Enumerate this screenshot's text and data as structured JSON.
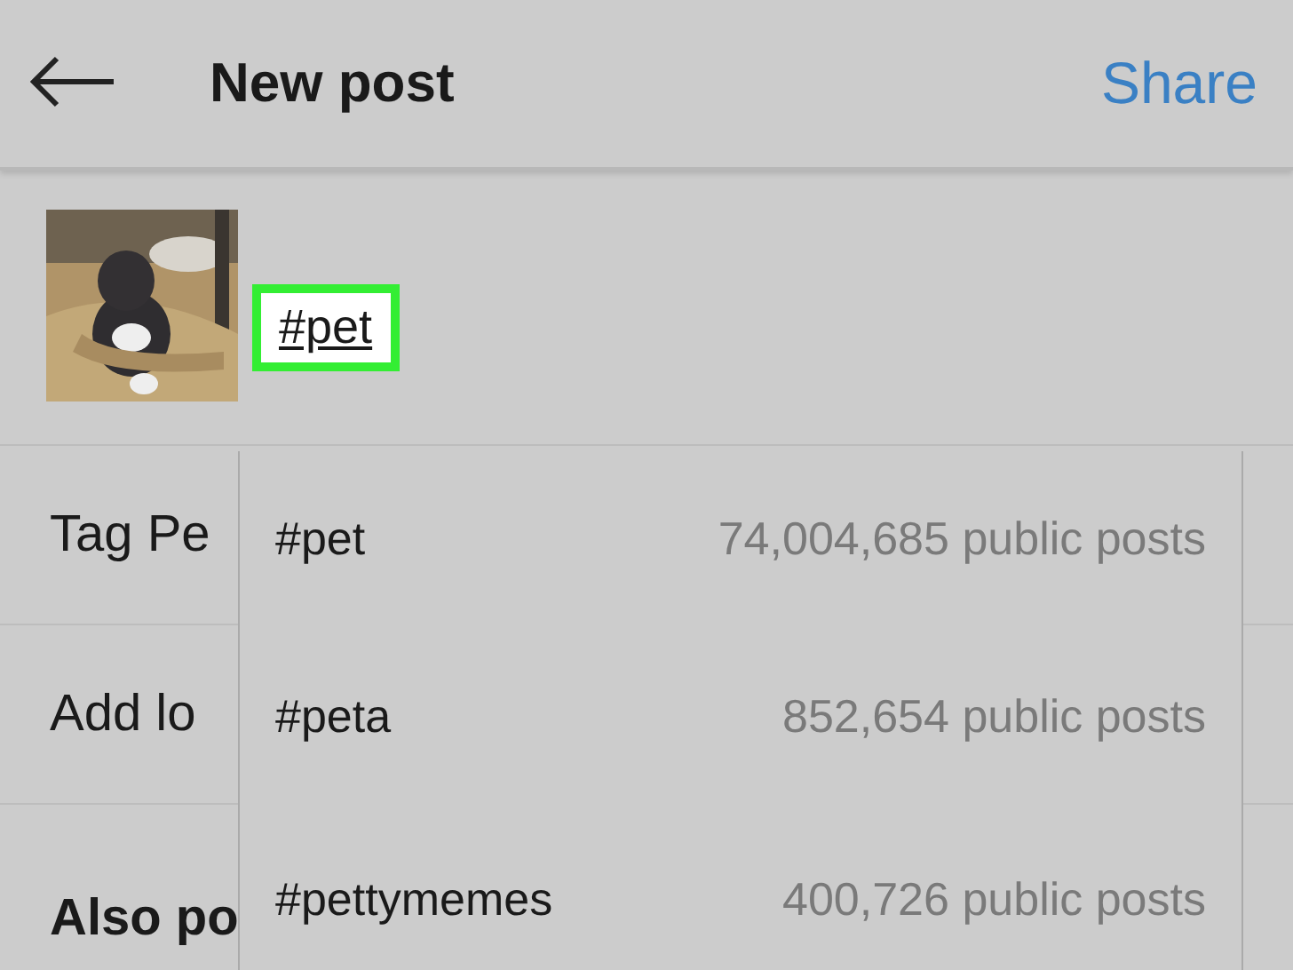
{
  "header": {
    "title": "New post",
    "action": "Share"
  },
  "caption": {
    "value": "#pet",
    "highlighted": true
  },
  "options": [
    {
      "label": "Tag Pe",
      "bold": false
    },
    {
      "label": "Add lo",
      "bold": false
    },
    {
      "label": "Also po",
      "bold": true
    }
  ],
  "suggestions": [
    {
      "tag": "#pet",
      "count": "74,004,685 public posts"
    },
    {
      "tag": "#peta",
      "count": "852,654 public posts"
    },
    {
      "tag": "#pettymemes",
      "count": "400,726 public posts"
    }
  ]
}
